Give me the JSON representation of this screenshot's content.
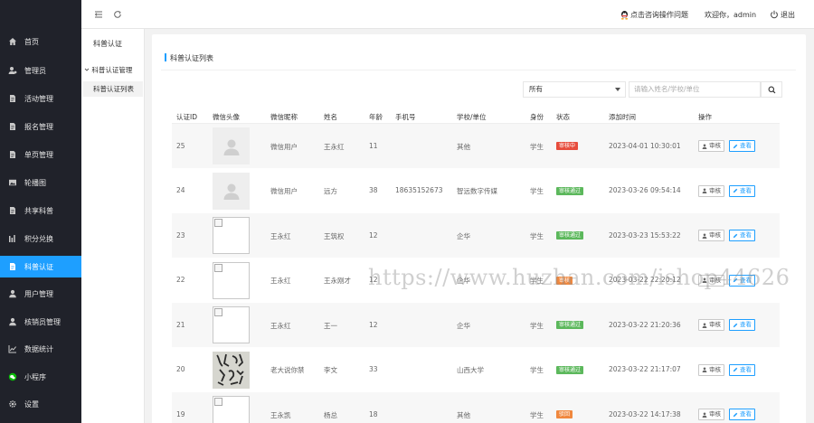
{
  "colors": {
    "sidebar_bg": "#20222a",
    "accent": "#1e9fff",
    "status_pending": "#e74c3c",
    "status_passed": "#5cb85c",
    "status_rejected": "#f0883e"
  },
  "sidebar": {
    "items": [
      {
        "label": "首页",
        "icon": "home-icon"
      },
      {
        "label": "管理员",
        "icon": "admin-user-icon"
      },
      {
        "label": "活动管理",
        "icon": "document-icon"
      },
      {
        "label": "报名管理",
        "icon": "document-icon"
      },
      {
        "label": "单页管理",
        "icon": "document-icon"
      },
      {
        "label": "轮播图",
        "icon": "image-icon"
      },
      {
        "label": "共享科普",
        "icon": "document-icon"
      },
      {
        "label": "积分兑换",
        "icon": "bars-icon"
      },
      {
        "label": "科普认证",
        "icon": "document-icon",
        "active": true
      },
      {
        "label": "用户管理",
        "icon": "user-icon"
      },
      {
        "label": "核销员管理",
        "icon": "user-icon"
      },
      {
        "label": "数据统计",
        "icon": "line-chart-icon"
      },
      {
        "label": "小程序",
        "icon": "wechat-icon"
      },
      {
        "label": "设置",
        "icon": "gear-icon"
      }
    ]
  },
  "header": {
    "consult_text": "点击咨询操作问题",
    "welcome_text": "欢迎你，admin",
    "logout_text": "退出"
  },
  "subnav": {
    "title": "科普认证",
    "group": "科普认证管理",
    "leaf": "科普认证列表"
  },
  "panel": {
    "title": "科普认证列表",
    "filter_select": "所有",
    "search_placeholder": "请输入姓名/学校/单位"
  },
  "table": {
    "columns": [
      "认证ID",
      "微信头像",
      "微信昵称",
      "姓名",
      "年龄",
      "手机号",
      "学校/单位",
      "身份",
      "状态",
      "添加时间",
      "操作"
    ],
    "actions": {
      "audit": "审核",
      "edit": "查看"
    },
    "rows": [
      {
        "id": "25",
        "avatar": "placeholder",
        "nickname": "微信用户",
        "name": "王永红",
        "age": "11",
        "phone": "",
        "school": "其他",
        "identity": "学生",
        "status": "审核中",
        "status_kind": "pending",
        "time": "2023-04-01 10:30:01"
      },
      {
        "id": "24",
        "avatar": "placeholder",
        "nickname": "微信用户",
        "name": "远方",
        "age": "38",
        "phone": "18635152673",
        "school": "智远数字传媒",
        "identity": "学生",
        "status": "审核通过",
        "status_kind": "passed",
        "time": "2023-03-26 09:54:14"
      },
      {
        "id": "23",
        "avatar": "broken",
        "nickname": "王永红",
        "name": "王筑权",
        "age": "12",
        "phone": "",
        "school": "企华",
        "identity": "学生",
        "status": "审核通过",
        "status_kind": "passed",
        "time": "2023-03-23 15:53:22"
      },
      {
        "id": "22",
        "avatar": "broken",
        "nickname": "王永红",
        "name": "王永刚才",
        "age": "12",
        "phone": "",
        "school": "企华",
        "identity": "学生",
        "status": "审核",
        "status_kind": "rejected",
        "time": "2023-03-22 22:20:12"
      },
      {
        "id": "21",
        "avatar": "broken",
        "nickname": "王永红",
        "name": "王一",
        "age": "12",
        "phone": "",
        "school": "企华",
        "identity": "学生",
        "status": "审核通过",
        "status_kind": "passed",
        "time": "2023-03-22 21:20:36"
      },
      {
        "id": "20",
        "avatar": "calligraphy",
        "nickname": "老大说你禁",
        "name": "李文",
        "age": "33",
        "phone": "",
        "school": "山西大学",
        "identity": "学生",
        "status": "审核通过",
        "status_kind": "passed",
        "time": "2023-03-22 21:17:07"
      },
      {
        "id": "19",
        "avatar": "broken",
        "nickname": "王永凯",
        "name": "杨总",
        "age": "18",
        "phone": "",
        "school": "其他",
        "identity": "学生",
        "status": "驳回",
        "status_kind": "rejected",
        "time": "2023-03-22 14:17:38"
      }
    ]
  },
  "watermark": "https://www.huzhan.com/ishop44626"
}
